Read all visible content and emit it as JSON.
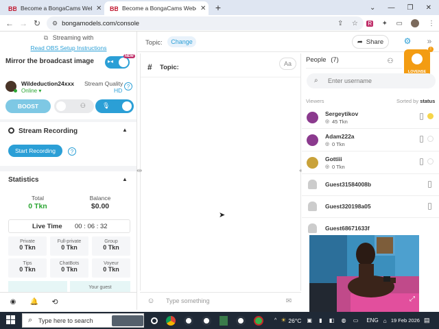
{
  "browser": {
    "tabs": [
      {
        "title": "Become a BongaCams Webcam",
        "active": false
      },
      {
        "title": "Become a BongaCams Webcam",
        "active": true
      }
    ],
    "url": "bongamodels.com/console"
  },
  "left": {
    "streaming_with": "Streaming with",
    "obs_link": "Read OBS Setup Instructions",
    "mirror_label": "Mirror the broadcast image",
    "username": "Wildeduction24xxx",
    "online": "Online",
    "quality_label": "Stream Quality",
    "quality_value": "HD",
    "boost": "BOOST",
    "new_badge": "NEW",
    "recording_title": "Stream Recording",
    "start_recording": "Start Recording",
    "stats_title": "Statistics",
    "total_label": "Total",
    "total_value": "0 Tkn",
    "balance_label": "Balance",
    "balance_value": "$0.00",
    "live_time_label": "Live Time",
    "live_time_value": "00 : 06 : 32",
    "stats": [
      {
        "label": "Private",
        "value": "0 Tkn"
      },
      {
        "label": "Full-private",
        "value": "0 Tkn"
      },
      {
        "label": "Group",
        "value": "0 Tkn"
      },
      {
        "label": "Tips",
        "value": "0 Tkn"
      },
      {
        "label": "ChatBots",
        "value": "0 Tkn"
      },
      {
        "label": "Voyeur",
        "value": "0 Tkn"
      }
    ],
    "your_guest": "Your guest"
  },
  "center": {
    "topic_label": "Topic:",
    "change": "Change",
    "share": "Share",
    "chat_topic": "Topic:",
    "font_btn": "Aa",
    "input_placeholder": "Type something"
  },
  "right": {
    "people_label": "People",
    "people_count": "(7)",
    "search_placeholder": "Enter username",
    "viewers_label": "Viewers",
    "sorted_by": "Sorted by",
    "sorted_value": "status",
    "lovense": "LOVENSE",
    "viewers": [
      {
        "name": "Sergeytikov",
        "tokens": "45 Tkn"
      },
      {
        "name": "Adam222a",
        "tokens": "0 Tkn"
      },
      {
        "name": "Gottiii",
        "tokens": "0 Tkn"
      },
      {
        "name": "Guest31584008b",
        "tokens": ""
      },
      {
        "name": "Guest320198a05",
        "tokens": ""
      },
      {
        "name": "Guest68671633f",
        "tokens": ""
      }
    ]
  },
  "taskbar": {
    "search_placeholder": "Type here to search",
    "temperature": "26°C",
    "language": "ENG",
    "date": "19 Feb 2026"
  },
  "colors": {
    "accent": "#2b9fd6",
    "green": "#2aa532",
    "orange": "#f39c12",
    "taskbar": "#1f2936"
  }
}
